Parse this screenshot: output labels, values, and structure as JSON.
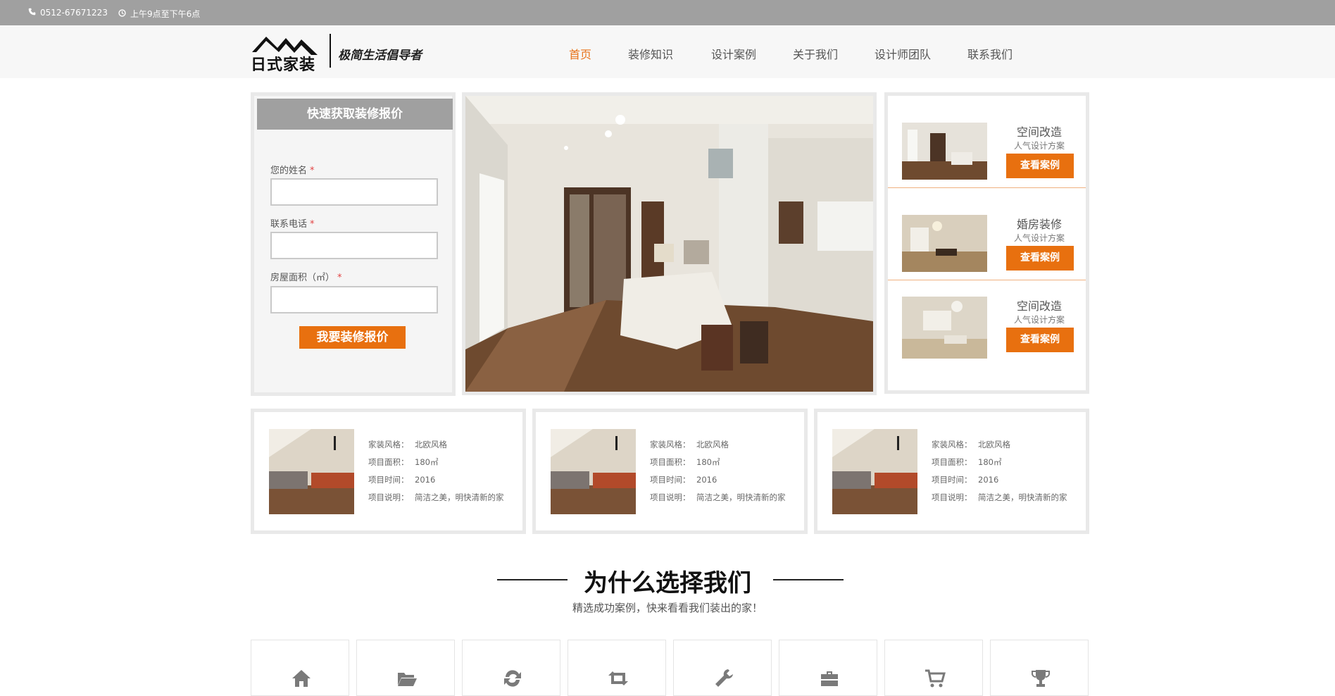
{
  "topbar": {
    "phone_icon": "phone-icon",
    "phone": "0512-67671223",
    "clock_icon": "clock-icon",
    "hours": "上午9点至下午6点"
  },
  "logo": {
    "brand": "日式家装",
    "slogan": "极简生活倡导者"
  },
  "nav": {
    "items": [
      "首页",
      "装修知识",
      "设计案例",
      "关于我们",
      "设计师团队",
      "联系我们"
    ],
    "active_index": 0
  },
  "quote_form": {
    "title": "快速获取装修报价",
    "fields": [
      {
        "label": "您的姓名",
        "required_mark": "*",
        "value": ""
      },
      {
        "label": "联系电话",
        "required_mark": "*",
        "value": ""
      },
      {
        "label": "房屋面积（㎡）",
        "required_mark": "*",
        "value": ""
      }
    ],
    "submit_label": "我要装修报价"
  },
  "side_cases": [
    {
      "name": "空间改造",
      "sub": "人气设计方案",
      "button": "查看案例"
    },
    {
      "name": "婚房装修",
      "sub": "人气设计方案",
      "button": "查看案例"
    },
    {
      "name": "空间改造",
      "sub": "人气设计方案",
      "button": "查看案例"
    }
  ],
  "cases": [
    {
      "rows": [
        {
          "k": "家装风格：",
          "v": "北欧风格"
        },
        {
          "k": "项目面积：",
          "v": "180㎡"
        },
        {
          "k": "项目时间：",
          "v": "2016"
        },
        {
          "k": "项目说明：",
          "v": "简洁之美，明快清新的家"
        }
      ]
    },
    {
      "rows": [
        {
          "k": "家装风格：",
          "v": "北欧风格"
        },
        {
          "k": "项目面积：",
          "v": "180㎡"
        },
        {
          "k": "项目时间：",
          "v": "2016"
        },
        {
          "k": "项目说明：",
          "v": "简洁之美，明快清新的家"
        }
      ]
    },
    {
      "rows": [
        {
          "k": "家装风格：",
          "v": "北欧风格"
        },
        {
          "k": "项目面积：",
          "v": "180㎡"
        },
        {
          "k": "项目时间：",
          "v": "2016"
        },
        {
          "k": "项目说明：",
          "v": "简洁之美，明快清新的家"
        }
      ]
    }
  ],
  "why": {
    "title": "为什么选择我们",
    "subtitle": "精选成功案例，快来看看我们装出的家！"
  },
  "features": [
    "home-icon",
    "folder-open-icon",
    "refresh-icon",
    "retweet-icon",
    "wrench-icon",
    "briefcase-icon",
    "cart-icon",
    "trophy-icon"
  ],
  "colors": {
    "accent": "#e8700f",
    "nav_active": "#e8731a",
    "topbar": "#a0a0a0"
  }
}
